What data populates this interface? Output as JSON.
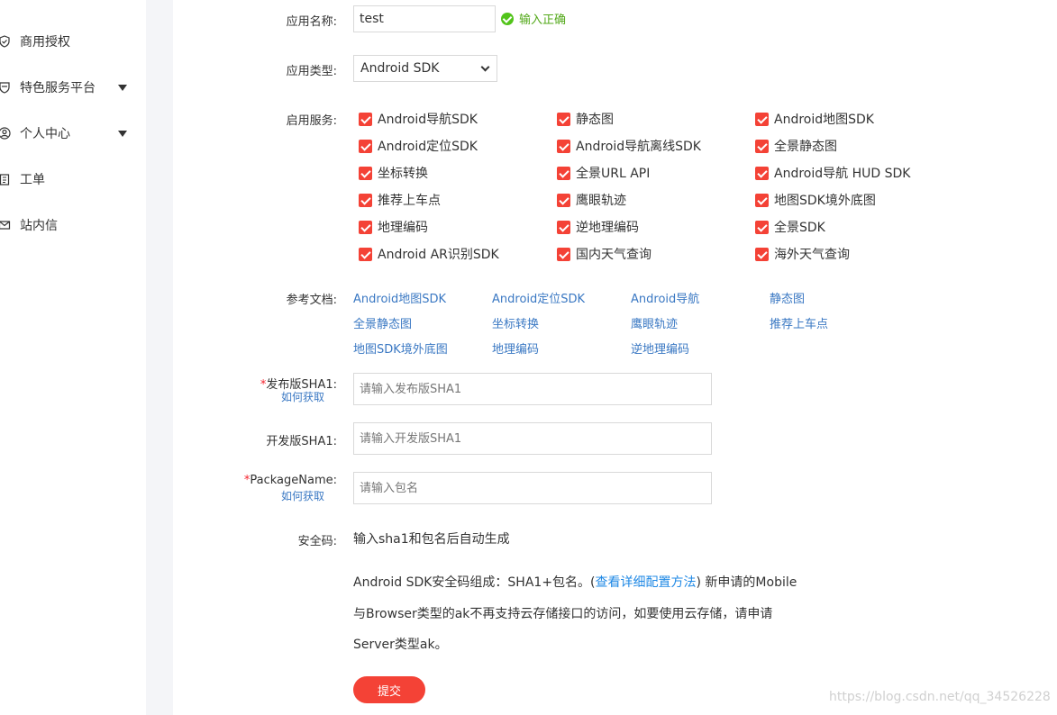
{
  "sidebar": {
    "items": [
      {
        "label": "商用授权",
        "icon": "shield-check-icon"
      },
      {
        "label": "特色服务平台",
        "icon": "heart-shield-icon"
      },
      {
        "label": "个人中心",
        "icon": "user-circle-icon"
      },
      {
        "label": "工单",
        "icon": "clipboard-icon"
      },
      {
        "label": "站内信",
        "icon": "envelope-icon"
      }
    ]
  },
  "form": {
    "app_name": {
      "label": "应用名称:",
      "value": "test",
      "validation": "输入正确"
    },
    "app_type": {
      "label": "应用类型:",
      "value": "Android SDK"
    },
    "services": {
      "label": "启用服务:",
      "items": [
        "Android导航SDK",
        "静态图",
        "Android地图SDK",
        "Android定位SDK",
        "Android导航离线SDK",
        "全景静态图",
        "坐标转换",
        "全景URL API",
        "Android导航 HUD SDK",
        "推荐上车点",
        "鹰眼轨迹",
        "地图SDK境外底图",
        "地理编码",
        "逆地理编码",
        "全景SDK",
        "Android AR识别SDK",
        "国内天气查询",
        "海外天气查询"
      ]
    },
    "docs": {
      "label": "参考文档:",
      "links": [
        "Android地图SDK",
        "Android定位SDK",
        "Android导航",
        "静态图",
        "全景静态图",
        "坐标转换",
        "鹰眼轨迹",
        "推荐上车点",
        "地图SDK境外底图",
        "地理编码",
        "逆地理编码"
      ]
    },
    "release_sha1": {
      "required": "*",
      "label": "发布版SHA1:",
      "help": "如何获取",
      "placeholder": "请输入发布版SHA1"
    },
    "dev_sha1": {
      "label": "开发版SHA1:",
      "placeholder": "请输入开发版SHA1"
    },
    "package_name": {
      "required": "*",
      "label": "PackageName:",
      "help": "如何获取",
      "placeholder": "请输入包名"
    },
    "security_code": {
      "label": "安全码:",
      "value": "输入sha1和包名后自动生成"
    },
    "note": {
      "line1_pre": "Android SDK安全码组成：SHA1+包名。(",
      "line1_link": "查看详细配置方法",
      "line1_post": ") 新申请的Mobile",
      "line2": "与Browser类型的ak不再支持云存储接口的访问，如要使用云存储，请申请",
      "line3": "Server类型ak。"
    },
    "submit_label": "提交"
  },
  "watermark": "https://blog.csdn.net/qq_34526228",
  "colors": {
    "accent": "#f44236",
    "link": "#3a78c3",
    "success": "#52c41a"
  }
}
